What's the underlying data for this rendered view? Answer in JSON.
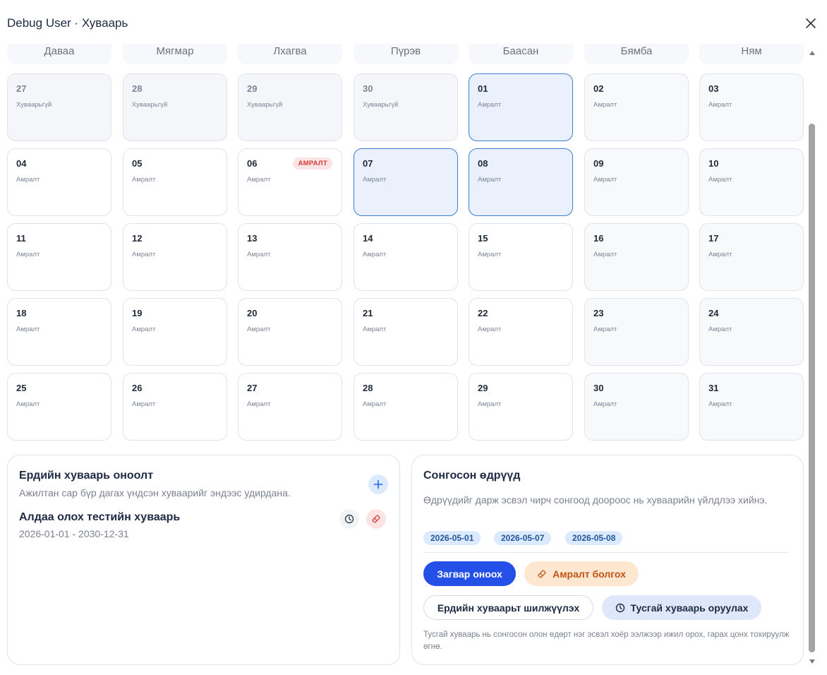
{
  "window": {
    "title": "Debug User · Хуваарь"
  },
  "weekdays": [
    "Даваа",
    "Мягмар",
    "Лхагва",
    "Пүрэв",
    "Баасан",
    "Бямба",
    "Ням"
  ],
  "calendar": [
    {
      "day": "27",
      "status": "Хуваарьгүй",
      "outside": true
    },
    {
      "day": "28",
      "status": "Хуваарьгүй",
      "outside": true
    },
    {
      "day": "29",
      "status": "Хуваарьгүй",
      "outside": true
    },
    {
      "day": "30",
      "status": "Хуваарьгүй",
      "outside": true
    },
    {
      "day": "01",
      "status": "Амралт",
      "selected": true
    },
    {
      "day": "02",
      "status": "Амралт",
      "weekend": true
    },
    {
      "day": "03",
      "status": "Амралт",
      "weekend": true
    },
    {
      "day": "04",
      "status": "Амралт"
    },
    {
      "day": "05",
      "status": "Амралт"
    },
    {
      "day": "06",
      "status": "Амралт",
      "badge": "АМРАЛТ"
    },
    {
      "day": "07",
      "status": "Амралт",
      "selected": true
    },
    {
      "day": "08",
      "status": "Амралт",
      "selected": true
    },
    {
      "day": "09",
      "status": "Амралт",
      "weekend": true
    },
    {
      "day": "10",
      "status": "Амралт",
      "weekend": true
    },
    {
      "day": "11",
      "status": "Амралт"
    },
    {
      "day": "12",
      "status": "Амралт"
    },
    {
      "day": "13",
      "status": "Амралт"
    },
    {
      "day": "14",
      "status": "Амралт"
    },
    {
      "day": "15",
      "status": "Амралт"
    },
    {
      "day": "16",
      "status": "Амралт",
      "weekend": true
    },
    {
      "day": "17",
      "status": "Амралт",
      "weekend": true
    },
    {
      "day": "18",
      "status": "Амралт"
    },
    {
      "day": "19",
      "status": "Амралт"
    },
    {
      "day": "20",
      "status": "Амралт"
    },
    {
      "day": "21",
      "status": "Амралт"
    },
    {
      "day": "22",
      "status": "Амралт"
    },
    {
      "day": "23",
      "status": "Амралт",
      "weekend": true
    },
    {
      "day": "24",
      "status": "Амралт",
      "weekend": true
    },
    {
      "day": "25",
      "status": "Амралт"
    },
    {
      "day": "26",
      "status": "Амралт"
    },
    {
      "day": "27",
      "status": "Амралт"
    },
    {
      "day": "28",
      "status": "Амралт"
    },
    {
      "day": "29",
      "status": "Амралт"
    },
    {
      "day": "30",
      "status": "Амралт",
      "weekend": true
    },
    {
      "day": "31",
      "status": "Амралт",
      "weekend": true
    }
  ],
  "regular": {
    "title": "Ердийн хуваарь оноолт",
    "description": "Ажилтан сар бүр дагах үндсэн хуваарийг эндээс удирдана.",
    "schedule_name": "Алдаа олох тестийн хуваарь",
    "schedule_range": "2026-01-01 - 2030-12-31",
    "add_icon": "plus-icon",
    "clock_icon": "clock-icon",
    "eraser_icon": "eraser-icon"
  },
  "selected": {
    "title": "Сонгосон өдрүүд",
    "description": "Өдрүүдийг дарж эсвэл чирч сонгоод доороос нь хуваарийн үйлдлээ хийнэ.",
    "dates": [
      "2026-05-01",
      "2026-05-07",
      "2026-05-08"
    ],
    "apply_template": "Загвар оноох",
    "make_rest": "Амралт болгох",
    "move_regular": "Ердийн хуваарьт шилжүүлэх",
    "add_custom": "Тусгай хуваарь оруулах",
    "note": "Тусгай хуваарь нь сонгосон олон өдөрт нэг эсвэл хоёр ээлжээр ижил орох, гарах цонх тохируулж өгнө."
  },
  "colors": {
    "accent": "#2550e8",
    "selected_day_bg": "#eaf1fc",
    "selected_day_border": "#3b7fd1",
    "rest_badge": "#d23b3b",
    "rest_button_bg": "#fde7d1"
  }
}
